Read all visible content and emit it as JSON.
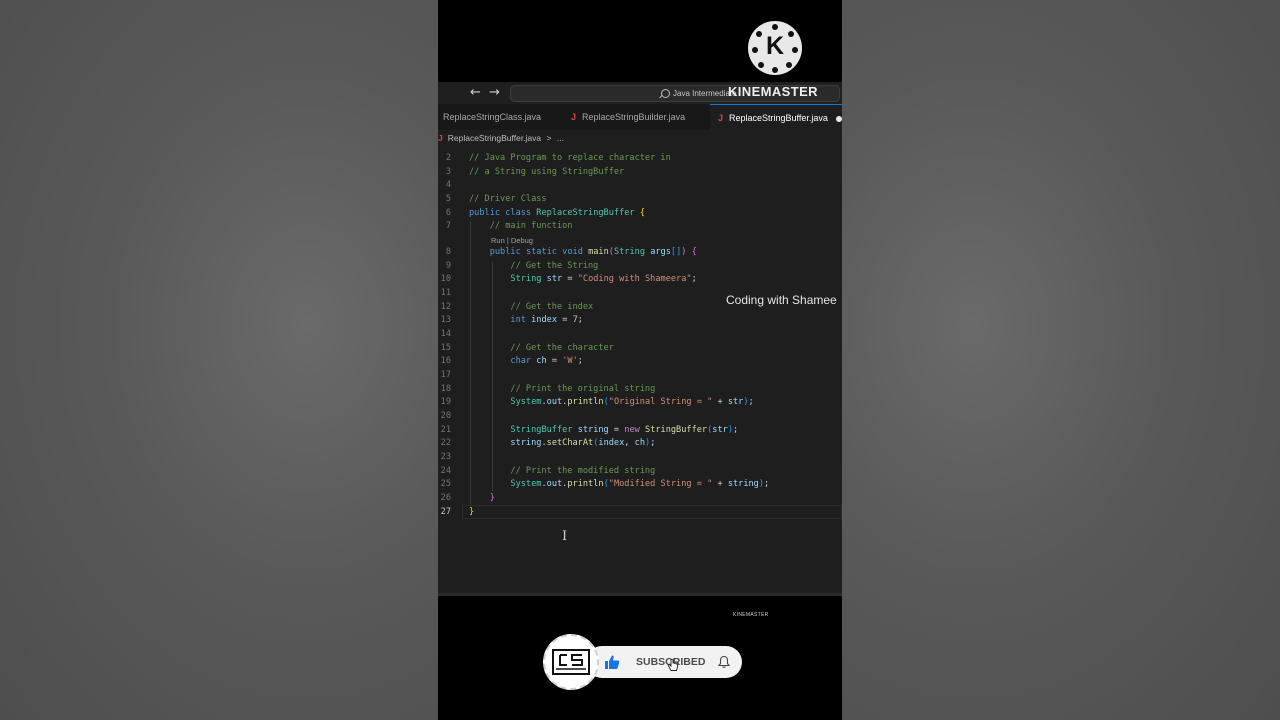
{
  "browser": {
    "search_text": "Java Intermediate"
  },
  "tabs": [
    {
      "label": "ReplaceStringClass.java",
      "icon": "java-file-icon"
    },
    {
      "label": "ReplaceStringBuilder.java",
      "icon": "java-file-icon"
    },
    {
      "label": "ReplaceStringBuffer.java",
      "icon": "java-file-icon",
      "active": true,
      "modified": true
    }
  ],
  "breadcrumb": {
    "file": "ReplaceStringBuffer.java",
    "separator": ">",
    "more": "..."
  },
  "editor": {
    "current_line": "27",
    "codelens": "Run | Debug",
    "lines": [
      {
        "n": "2",
        "text": "// Java Program to replace character in"
      },
      {
        "n": "3",
        "text": "// a String using StringBuffer"
      },
      {
        "n": "4",
        "text": ""
      },
      {
        "n": "5",
        "text": "// Driver Class"
      },
      {
        "n": "6",
        "text": "public class ReplaceStringBuffer {"
      },
      {
        "n": "7",
        "text": "    // main function"
      },
      {
        "n": "8",
        "text": "    public static void main(String args[]) {"
      },
      {
        "n": "9",
        "text": "        // Get the String"
      },
      {
        "n": "10",
        "text": "        String str = \"Coding with Shameera\";"
      },
      {
        "n": "11",
        "text": ""
      },
      {
        "n": "12",
        "text": "        // Get the index"
      },
      {
        "n": "13",
        "text": "        int index = 7;"
      },
      {
        "n": "14",
        "text": ""
      },
      {
        "n": "15",
        "text": "        // Get the character"
      },
      {
        "n": "16",
        "text": "        char ch = 'W';"
      },
      {
        "n": "17",
        "text": ""
      },
      {
        "n": "18",
        "text": "        // Print the original string"
      },
      {
        "n": "19",
        "text": "        System.out.println(\"Original String = \" + str);"
      },
      {
        "n": "20",
        "text": ""
      },
      {
        "n": "21",
        "text": "        StringBuffer string = new StringBuffer(str);"
      },
      {
        "n": "22",
        "text": "        string.setCharAt(index, ch);"
      },
      {
        "n": "23",
        "text": ""
      },
      {
        "n": "24",
        "text": "        // Print the modified string"
      },
      {
        "n": "25",
        "text": "        System.out.println(\"Modified String = \" + string);"
      },
      {
        "n": "26",
        "text": "    }"
      },
      {
        "n": "27",
        "text": "}"
      }
    ]
  },
  "overlay": {
    "watermark": "Coding with Shamee",
    "kinemaster_text": "KINEMASTER",
    "kinemaster_logo_letter": "K",
    "kinemaster_small": "KINEMASTER",
    "subscribe_label": "SUBSCRIBED"
  },
  "colors": {
    "comment": "#6a9955",
    "keyword": "#569cd6",
    "type": "#4ec9b0",
    "variable": "#9cdcfe",
    "function": "#dcdcaa",
    "string": "#ce9178",
    "number": "#b5cea8",
    "editor_bg": "#1e1e1e",
    "accent": "#0e7ad4",
    "java_icon": "#e0433f",
    "like_blue": "#1a73e8"
  }
}
